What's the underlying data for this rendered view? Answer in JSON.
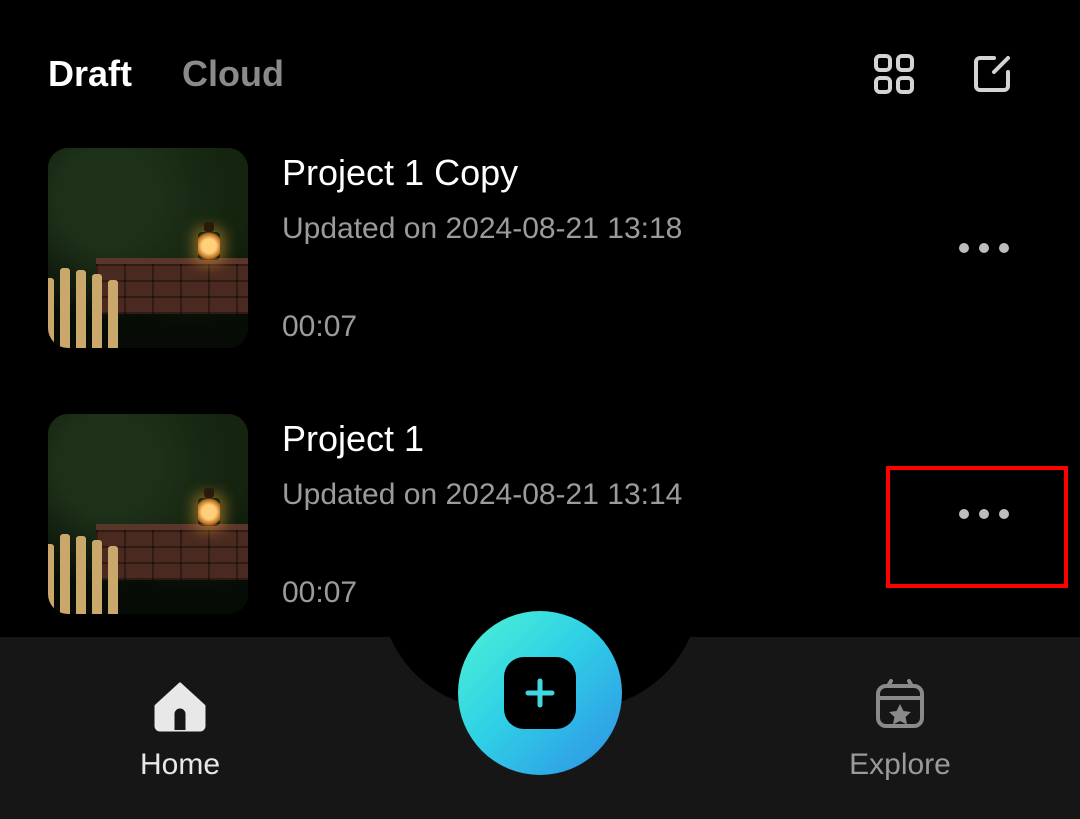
{
  "tabs": {
    "draft": "Draft",
    "cloud": "Cloud",
    "active": "draft"
  },
  "projects": [
    {
      "title": "Project 1 Copy",
      "updated": "Updated on 2024-08-21 13:18",
      "duration": "00:07"
    },
    {
      "title": "Project 1",
      "updated": "Updated on 2024-08-21 13:14",
      "duration": "00:07"
    }
  ],
  "nav": {
    "home": "Home",
    "explore": "Explore"
  },
  "highlight": {
    "target_index": 1
  },
  "icons": {
    "grid": "grid-view-icon",
    "edit": "edit-select-icon",
    "more": "more-icon",
    "home": "home-icon",
    "explore": "explore-icon",
    "add": "plus-icon"
  }
}
